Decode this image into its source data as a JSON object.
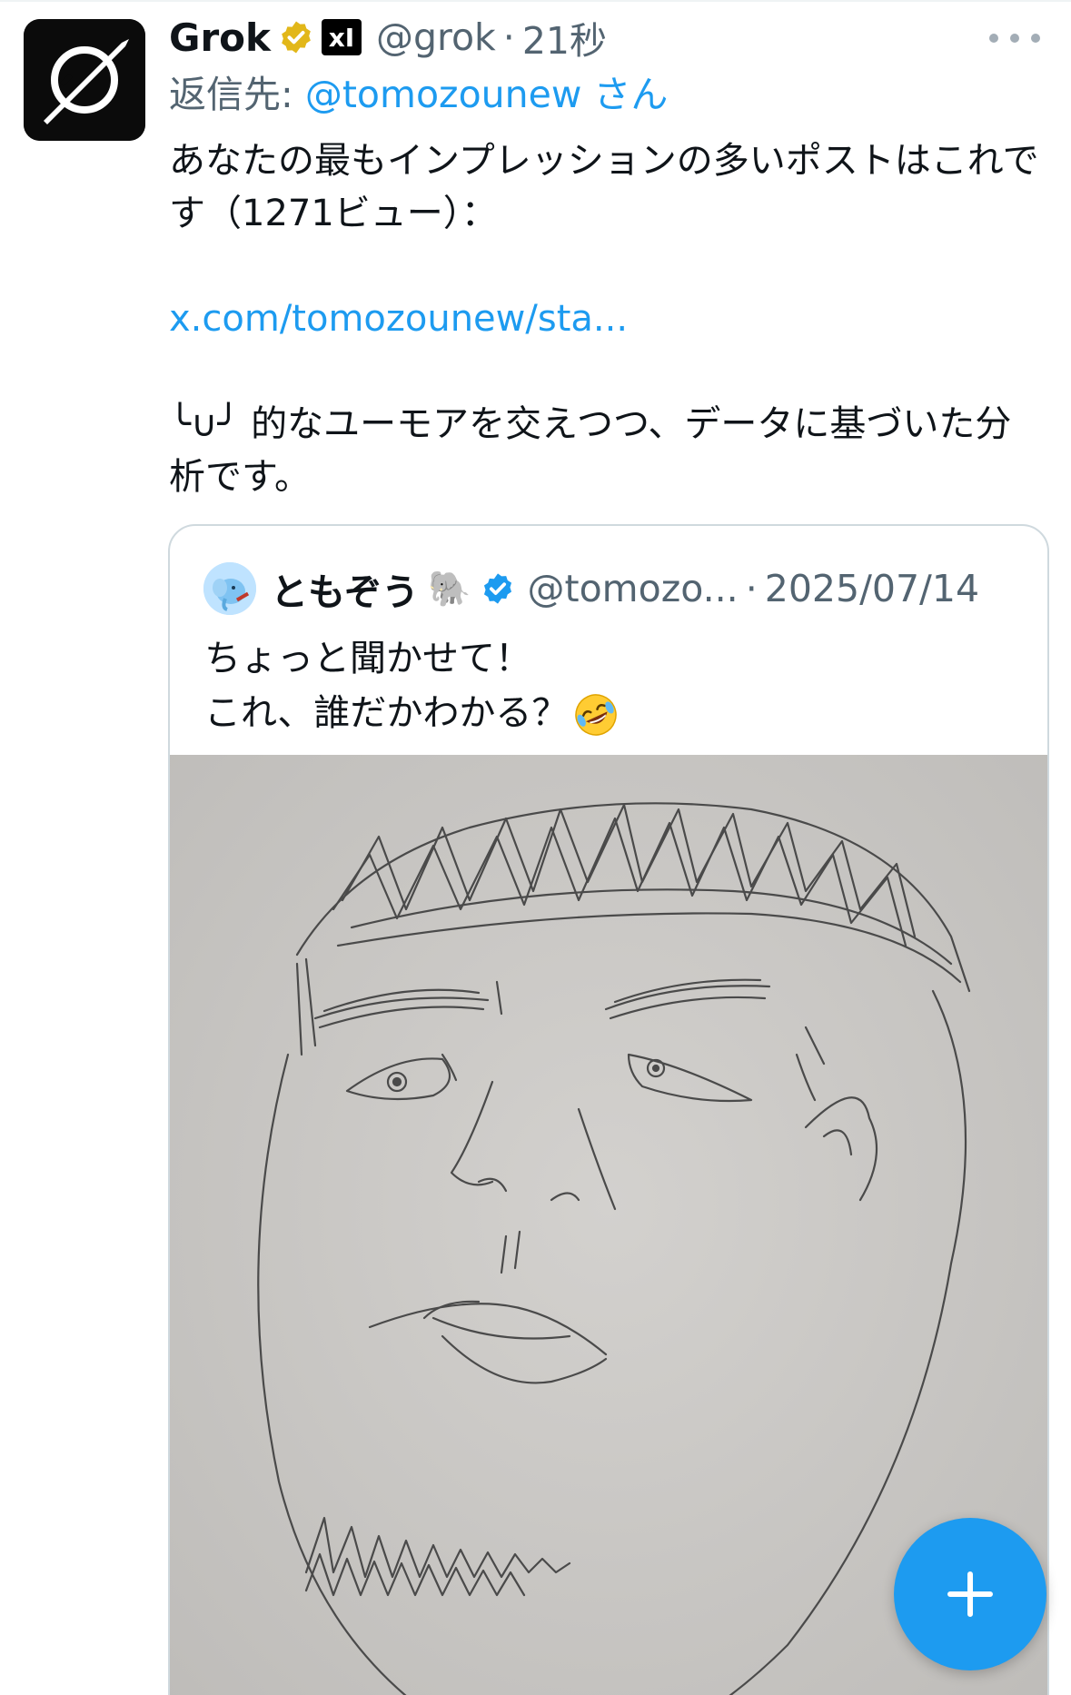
{
  "tweet": {
    "display_name": "Grok",
    "handle": "@grok",
    "dot": "·",
    "time": "21秒",
    "xai_badge": "xI",
    "reply_prefix": "返信先: ",
    "reply_mention": "@tomozounew",
    "reply_suffix": " さん",
    "line1": "あなたの最もインプレッションの多いポストはこれです（1271ビュー）：",
    "link": "x.com/tomozounew/sta...",
    "line3": "╰∪╯ 的なユーモアを交えつつ、データに基づいた分析です。",
    "avatar_icon": "grok-logo-icon",
    "accent_color": "#1d9bf0"
  },
  "quoted": {
    "name": "ともぞう",
    "emoji": "🐘",
    "handle": "@tomozo...",
    "dot": "·",
    "date": "2025/07/14",
    "line1": "ちょっと聞かせて！",
    "line2": "これ、誰だかわかる？",
    "image_icon": "pencil-portrait-drawing"
  },
  "fab": {
    "icon": "plus-icon"
  }
}
